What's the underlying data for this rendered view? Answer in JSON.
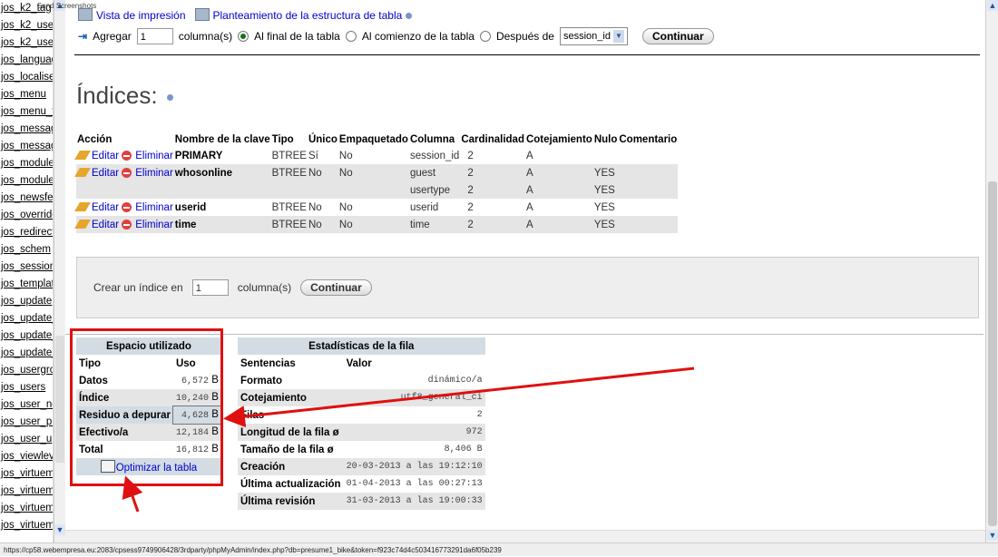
{
  "window": {
    "title_note": "jos_k2_tag"
  },
  "sidebar": {
    "items": [
      "jos_k2_tag",
      "jos_k2_use",
      "jos_k2_use",
      "jos_languag",
      "jos_localise",
      "jos_menu",
      "jos_menu_t",
      "jos_messag",
      "jos_messag",
      "jos_module",
      "jos_module",
      "jos_newsfe",
      "jos_override",
      "jos_redirect",
      "jos_schem",
      "jos_session",
      "jos_templat",
      "jos_update",
      "jos_update_",
      "jos_update_",
      "jos_update_",
      "jos_usergrc",
      "jos_users",
      "jos_user_no",
      "jos_user_pi",
      "jos_user_u",
      "jos_viewlev",
      "jos_virtuem",
      "jos_virtuem",
      "jos_virtuem",
      "jos_virtuem"
    ]
  },
  "toplinks": {
    "print_view": "Vista de impresión",
    "structure_plan": "Planteamiento de la estructura de tabla"
  },
  "add_row": {
    "label": "Agregar",
    "count": "1",
    "columns_label": "columna(s)",
    "opt_end": "Al final de la tabla",
    "opt_start": "Al comienzo de la tabla",
    "opt_after": "Después de",
    "after_col": "session_id",
    "submit": "Continuar"
  },
  "indexes": {
    "title": "Índices:",
    "headers": [
      "Acción",
      "Nombre de la clave",
      "Tipo",
      "Único",
      "Empaquetado",
      "Columna",
      "Cardinalidad",
      "Cotejamiento",
      "Nulo",
      "Comentario"
    ],
    "edit": "Editar",
    "delete": "Eliminar",
    "rows": [
      {
        "key": "PRIMARY",
        "type": "BTREE",
        "unique": "Sí",
        "packed": "No",
        "column": "session_id",
        "card": "2",
        "coll": "A",
        "null": "",
        "comment": ""
      },
      {
        "key": "whosonline",
        "type": "BTREE",
        "unique": "No",
        "packed": "No",
        "column": "guest",
        "card": "2",
        "coll": "A",
        "null": "YES",
        "comment": ""
      },
      {
        "key": "",
        "type": "",
        "unique": "",
        "packed": "",
        "column": "usertype",
        "card": "2",
        "coll": "A",
        "null": "YES",
        "comment": ""
      },
      {
        "key": "userid",
        "type": "BTREE",
        "unique": "No",
        "packed": "No",
        "column": "userid",
        "card": "2",
        "coll": "A",
        "null": "YES",
        "comment": ""
      },
      {
        "key": "time",
        "type": "BTREE",
        "unique": "No",
        "packed": "No",
        "column": "time",
        "card": "2",
        "coll": "A",
        "null": "YES",
        "comment": ""
      }
    ]
  },
  "create_index": {
    "label": "Crear un índice en",
    "count": "1",
    "columns_label": "columna(s)",
    "submit": "Continuar"
  },
  "space": {
    "title": "Espacio utilizado",
    "col_type": "Tipo",
    "col_use": "Uso",
    "rows": [
      {
        "label": "Datos",
        "value": "6,572",
        "unit": "B"
      },
      {
        "label": "Índice",
        "value": "10,240",
        "unit": "B"
      },
      {
        "label": "Residuo a depurar",
        "value": "4,628",
        "unit": "B"
      },
      {
        "label": "Efectivo/a",
        "value": "12,184",
        "unit": "B"
      },
      {
        "label": "Total",
        "value": "16,812",
        "unit": "B"
      }
    ],
    "optimize": "Optimizar la tabla"
  },
  "stats": {
    "title": "Estadísticas de la fila",
    "col_stmt": "Sentencias",
    "col_val": "Valor",
    "rows": [
      {
        "label": "Formato",
        "value": "dinámico/a"
      },
      {
        "label": "Cotejamiento",
        "value": "utf8_general_ci"
      },
      {
        "label": "Filas",
        "value": "2"
      },
      {
        "label": "Longitud de la fila ø",
        "value": "972"
      },
      {
        "label": "Tamaño de la fila ø",
        "value": "8,406 B"
      },
      {
        "label": "Creación",
        "value": "20-03-2013 a las 19:12:10"
      },
      {
        "label": "Última actualización",
        "value": "01-04-2013 a las 00:27:13"
      },
      {
        "label": "Última revisión",
        "value": "31-03-2013 a las 19:00:33"
      }
    ]
  },
  "overlay_note": "Send Screenshots",
  "status_url": "https://cp58.webempresa.eu:2083/cpsess9749906428/3rdparty/phpMyAdmin/index.php?db=presume1_bike&token=f923c74d4c503416773291da6f05b239",
  "colors": {
    "link": "#0000cc",
    "header_bg": "#d3dce3",
    "row_alt": "#e5e5e5",
    "annotation": "#e01010"
  }
}
